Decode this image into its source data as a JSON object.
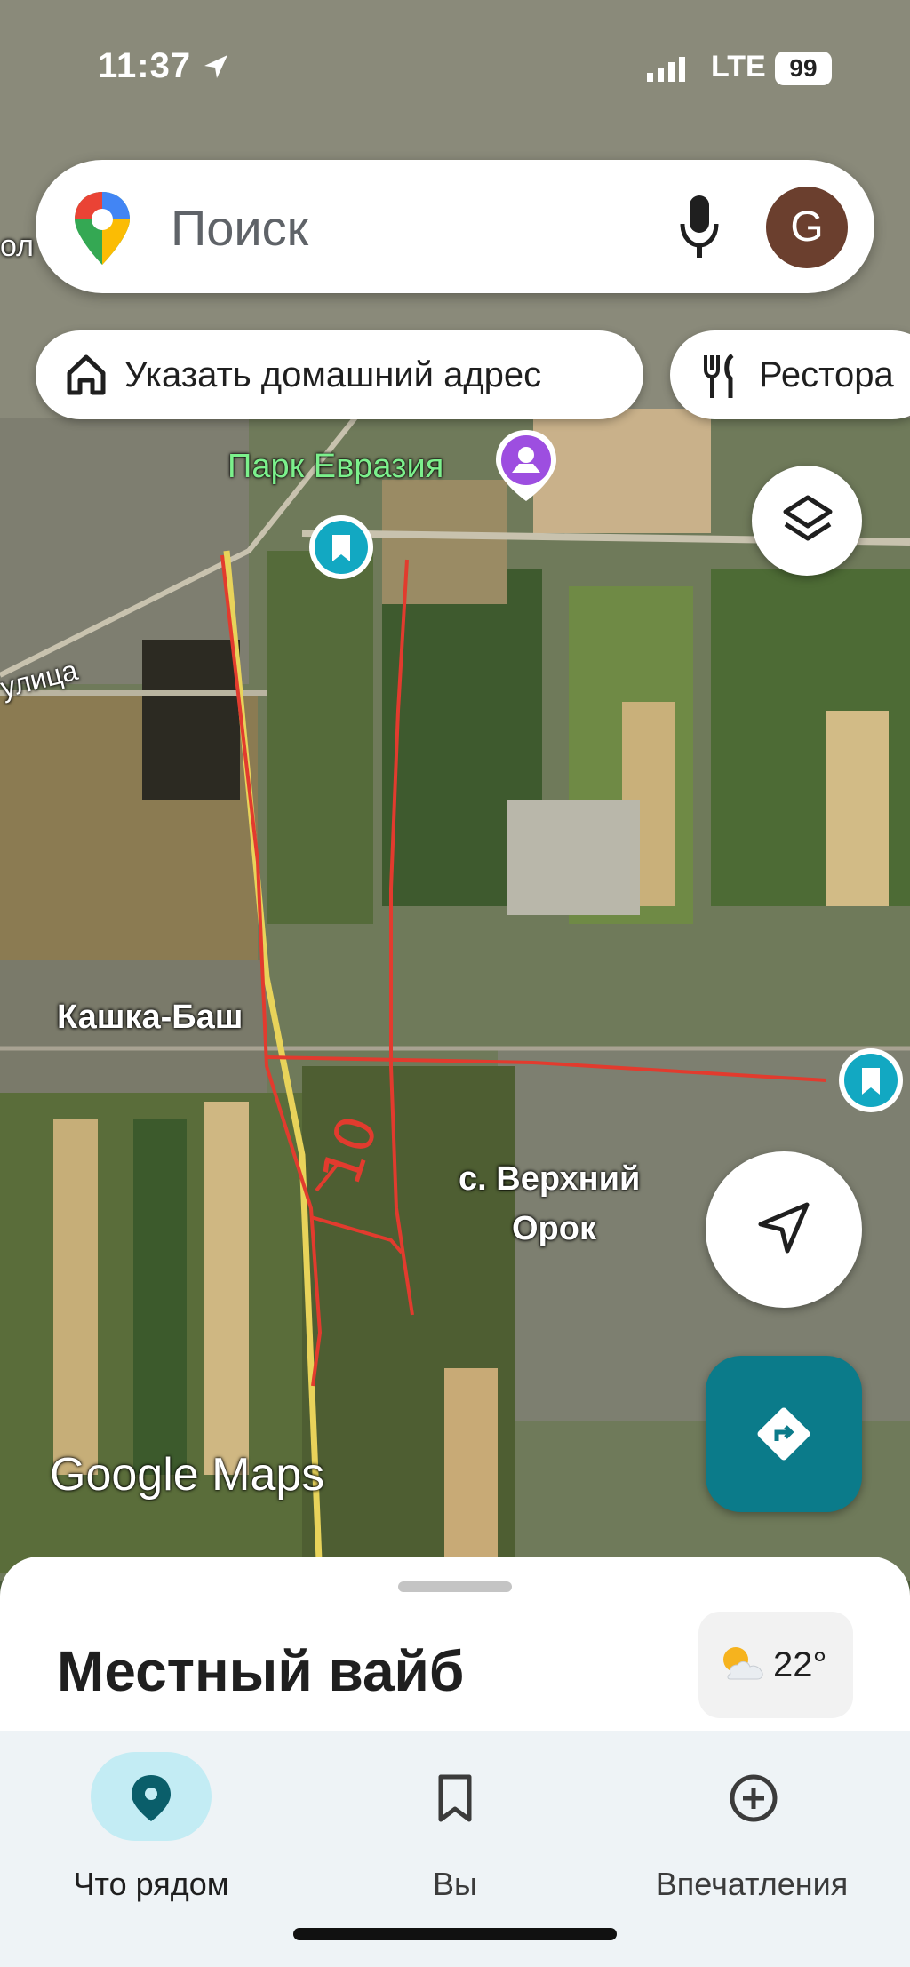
{
  "status_bar": {
    "time": "11:37",
    "network": "LTE",
    "battery": "99"
  },
  "search": {
    "placeholder": "Поиск",
    "avatar_letter": "G",
    "icons": [
      "maps-pin-icon",
      "mic-icon"
    ]
  },
  "chips": [
    {
      "label": "Указать домашний адрес",
      "icon": "home-icon"
    },
    {
      "label": "Рестора",
      "icon": "fork-knife-icon"
    }
  ],
  "map": {
    "labels": {
      "park": "Парк Евразия",
      "street": "улица",
      "village_left": "Кашка-Баш",
      "village_right_line1": "с. Верхний",
      "village_right_line2": "Орок",
      "partial_left": "ол"
    },
    "annotation": "10",
    "watermark": "Google Maps"
  },
  "bottom_sheet": {
    "title": "Местный вайб",
    "weather_temp": "22°",
    "weather_icon": "partly-cloudy-icon"
  },
  "nav": [
    {
      "label": "Что рядом",
      "icon": "explore-pin-icon",
      "active": true
    },
    {
      "label": "Вы",
      "icon": "bookmark-icon",
      "active": false
    },
    {
      "label": "Впечатления",
      "icon": "add-circle-icon",
      "active": false
    }
  ],
  "colors": {
    "accent": "#0b7b8a",
    "saved_pin": "#12a8c2",
    "annotation_red": "#e23b2e"
  }
}
